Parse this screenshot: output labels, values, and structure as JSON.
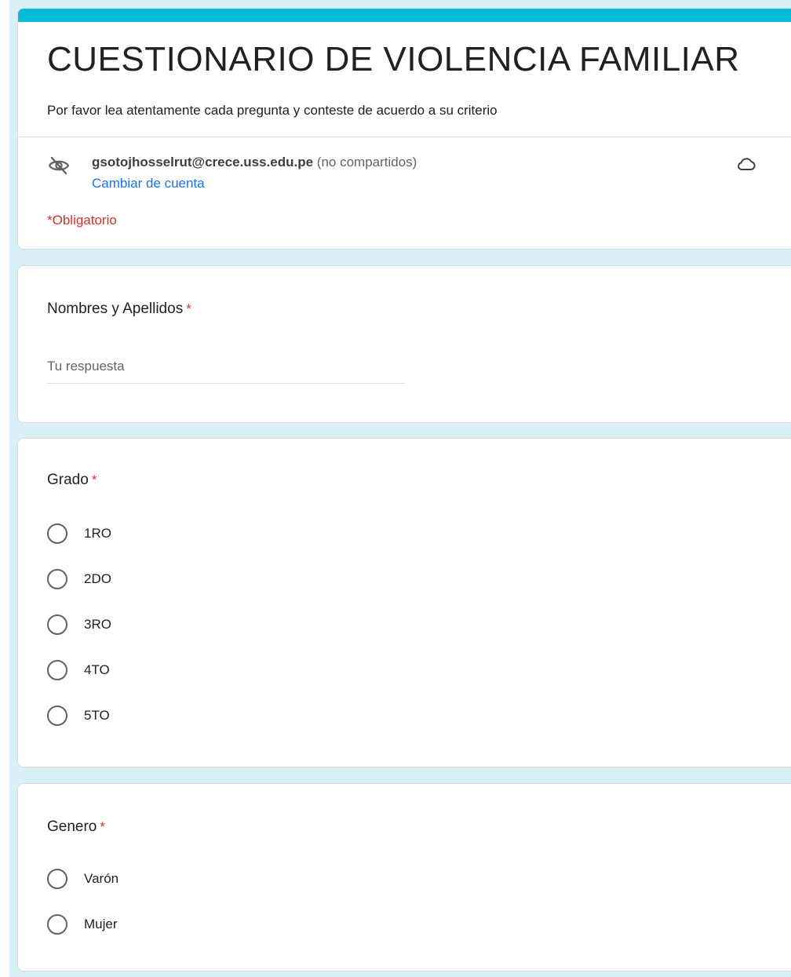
{
  "header": {
    "title": "CUESTIONARIO DE VIOLENCIA FAMILIAR",
    "description": "Por favor lea atentamente cada pregunta y conteste de acuerdo a su criterio",
    "account_email": "gsotojhosselrut@crece.uss.edu.pe",
    "account_note": "(no compartidos)",
    "switch_account": "Cambiar de cuenta",
    "required_note": "*Obligatorio"
  },
  "questions": {
    "name": {
      "title": "Nombres y Apellidos",
      "required_mark": "*",
      "placeholder": "Tu respuesta"
    },
    "grade": {
      "title": "Grado",
      "required_mark": "*",
      "options": [
        "1RO",
        "2DO",
        "3RO",
        "4TO",
        "5TO"
      ]
    },
    "gender": {
      "title": "Genero",
      "required_mark": "*",
      "options": [
        "Varón",
        "Mujer"
      ]
    }
  },
  "icons": {
    "visibility": "eye-off-icon",
    "save_status": "cloud-icon"
  },
  "colors": {
    "background": "#d9f1f6",
    "accent": "#00bcd4",
    "link": "#1a73e8",
    "required": "#d93025"
  }
}
